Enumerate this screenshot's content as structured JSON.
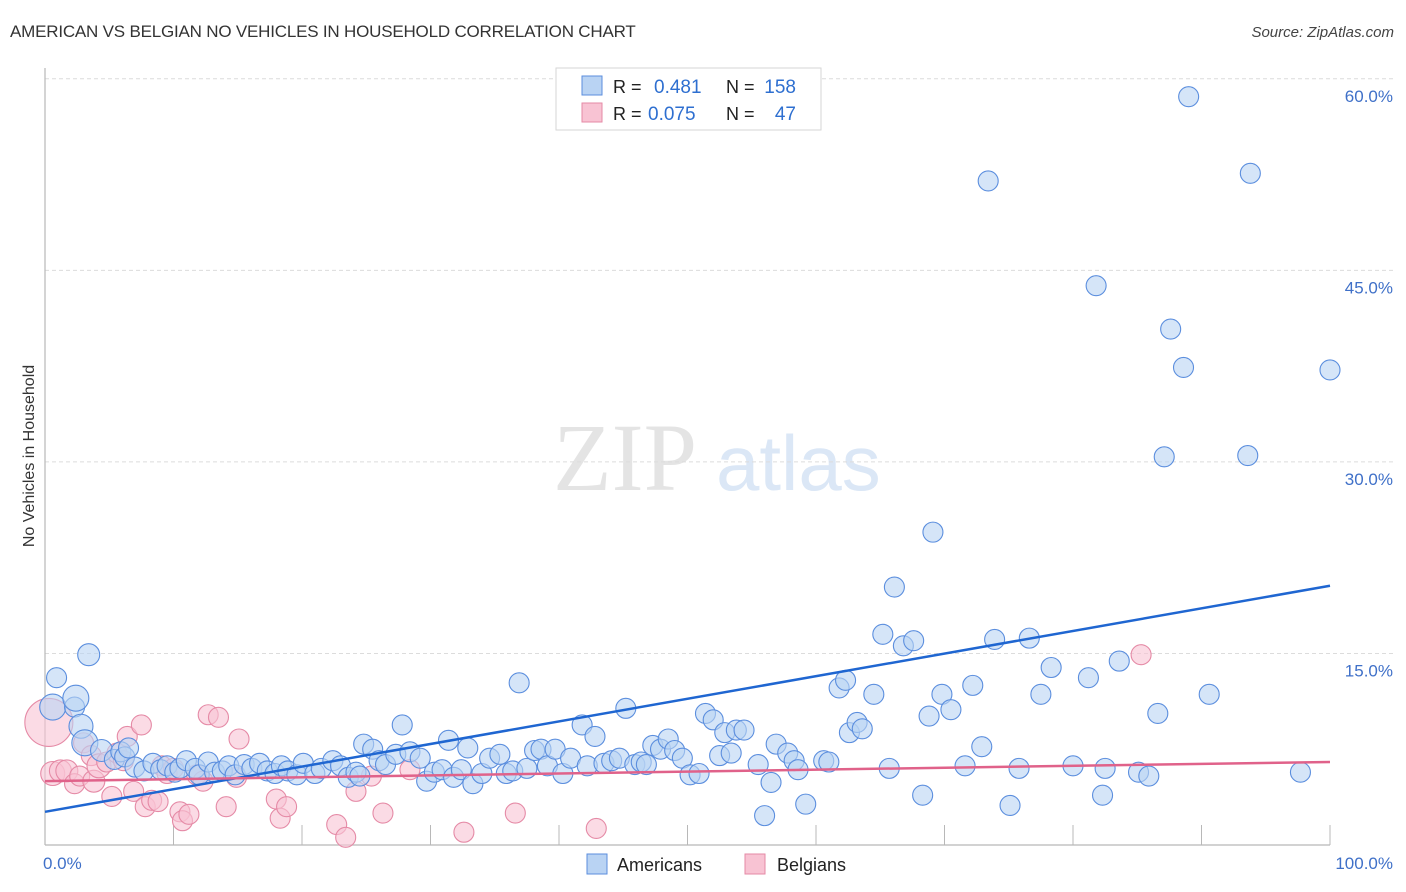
{
  "header": {
    "title": "AMERICAN VS BELGIAN NO VEHICLES IN HOUSEHOLD CORRELATION CHART",
    "source": "Source: ZipAtlas.com"
  },
  "watermark": {
    "zip": "ZIP",
    "atlas": "atlas"
  },
  "colors": {
    "americans_fill": "#b9d3f3",
    "americans_stroke": "#5b8ede",
    "americans_line": "#1f66d1",
    "belgians_fill": "#f8c3d3",
    "belgians_stroke": "#e58aa6",
    "belgians_line": "#e0628a",
    "tick_label": "#3f70c8"
  },
  "legend": {
    "rows": [
      {
        "series": "Americans",
        "r_label": "R =",
        "r_value": "0.481",
        "n_label": "N =",
        "n_value": "158"
      },
      {
        "series": "Belgians",
        "r_label": "R =",
        "r_value": "0.075",
        "n_label": "N =",
        "n_value": "47"
      }
    ]
  },
  "bottom_legend": [
    {
      "label": "Americans"
    },
    {
      "label": "Belgians"
    }
  ],
  "chart_data": {
    "type": "scatter",
    "title": "AMERICAN VS BELGIAN NO VEHICLES IN HOUSEHOLD CORRELATION CHART",
    "xlabel": "",
    "ylabel": "No Vehicles in Household",
    "xlim": [
      0,
      100
    ],
    "ylim": [
      0,
      60
    ],
    "x_tick_labels": [
      "0.0%",
      "100.0%"
    ],
    "y_ticks": [
      15,
      30,
      45,
      60
    ],
    "y_tick_labels": [
      "15.0%",
      "30.0%",
      "45.0%",
      "60.0%"
    ],
    "grid": "horizontal-dashed",
    "legend_position": "top-center",
    "series": [
      {
        "name": "Americans",
        "R": 0.481,
        "N": 158,
        "trend": {
          "x": [
            0,
            100
          ],
          "y": [
            2.6,
            20.3
          ]
        },
        "points": [
          [
            0.6,
            10.8,
            1.3
          ],
          [
            0.9,
            13.1,
            1.0
          ],
          [
            2.3,
            10.8,
            1.0
          ],
          [
            2.4,
            11.5,
            1.3
          ],
          [
            2.8,
            9.3,
            1.2
          ],
          [
            3.4,
            14.9,
            1.1
          ],
          [
            3.1,
            8.0,
            1.3
          ],
          [
            4.4,
            7.4,
            1.1
          ],
          [
            5.4,
            6.7,
            1.0
          ],
          [
            5.9,
            7.3,
            1.0
          ],
          [
            6.2,
            6.9,
            1.0
          ],
          [
            6.5,
            7.6,
            1.0
          ],
          [
            7.0,
            6.1,
            1.0
          ],
          [
            7.7,
            5.8,
            1.0
          ],
          [
            8.4,
            6.4,
            1.0
          ],
          [
            9.0,
            5.9,
            1.0
          ],
          [
            9.5,
            6.2,
            1.0
          ],
          [
            10.1,
            5.7,
            1.0
          ],
          [
            10.5,
            6.0,
            1.0
          ],
          [
            11.0,
            6.6,
            1.0
          ],
          [
            11.7,
            6.0,
            1.0
          ],
          [
            12.0,
            5.5,
            1.0
          ],
          [
            12.7,
            6.5,
            1.0
          ],
          [
            13.2,
            5.7,
            1.0
          ],
          [
            13.8,
            5.8,
            1.0
          ],
          [
            14.3,
            6.2,
            1.0
          ],
          [
            14.8,
            5.5,
            1.0
          ],
          [
            15.5,
            6.3,
            1.0
          ],
          [
            16.1,
            6.0,
            1.0
          ],
          [
            16.7,
            6.4,
            1.0
          ],
          [
            17.3,
            5.8,
            1.0
          ],
          [
            17.9,
            5.6,
            1.0
          ],
          [
            18.4,
            6.2,
            1.0
          ],
          [
            18.9,
            5.8,
            1.0
          ],
          [
            19.6,
            5.5,
            1.0
          ],
          [
            20.1,
            6.4,
            1.0
          ],
          [
            21.0,
            5.6,
            1.0
          ],
          [
            21.5,
            6.0,
            1.0
          ],
          [
            22.4,
            6.6,
            1.0
          ],
          [
            23.0,
            6.2,
            1.0
          ],
          [
            23.6,
            5.3,
            1.0
          ],
          [
            24.2,
            5.7,
            1.0
          ],
          [
            24.5,
            5.4,
            1.0
          ],
          [
            24.8,
            7.9,
            1.0
          ],
          [
            25.5,
            7.5,
            1.0
          ],
          [
            26.0,
            6.6,
            1.0
          ],
          [
            26.5,
            6.3,
            1.0
          ],
          [
            27.3,
            7.1,
            1.0
          ],
          [
            27.8,
            9.4,
            1.0
          ],
          [
            28.4,
            7.3,
            1.0
          ],
          [
            29.2,
            6.8,
            1.0
          ],
          [
            29.7,
            5.0,
            1.0
          ],
          [
            30.3,
            5.7,
            1.0
          ],
          [
            30.9,
            5.9,
            1.0
          ],
          [
            31.4,
            8.2,
            1.0
          ],
          [
            31.8,
            5.3,
            1.0
          ],
          [
            32.4,
            5.9,
            1.0
          ],
          [
            32.9,
            7.6,
            1.0
          ],
          [
            33.3,
            4.8,
            1.0
          ],
          [
            34.0,
            5.6,
            1.0
          ],
          [
            34.6,
            6.8,
            1.0
          ],
          [
            35.4,
            7.1,
            1.0
          ],
          [
            35.9,
            5.6,
            1.0
          ],
          [
            36.4,
            5.8,
            1.0
          ],
          [
            36.9,
            12.7,
            1.0
          ],
          [
            37.5,
            6.0,
            1.0
          ],
          [
            38.1,
            7.4,
            1.0
          ],
          [
            38.6,
            7.5,
            1.0
          ],
          [
            39.1,
            6.2,
            1.0
          ],
          [
            39.7,
            7.5,
            1.0
          ],
          [
            40.3,
            5.6,
            1.0
          ],
          [
            40.9,
            6.8,
            1.0
          ],
          [
            41.8,
            9.4,
            1.0
          ],
          [
            42.2,
            6.2,
            1.0
          ],
          [
            42.8,
            8.5,
            1.0
          ],
          [
            43.5,
            6.4,
            1.0
          ],
          [
            44.1,
            6.6,
            1.0
          ],
          [
            44.7,
            6.8,
            1.0
          ],
          [
            45.2,
            10.7,
            1.0
          ],
          [
            45.9,
            6.3,
            1.0
          ],
          [
            46.4,
            6.5,
            1.0
          ],
          [
            46.8,
            6.3,
            1.0
          ],
          [
            47.3,
            7.8,
            1.0
          ],
          [
            47.9,
            7.5,
            1.0
          ],
          [
            48.5,
            8.3,
            1.0
          ],
          [
            49.0,
            7.4,
            1.0
          ],
          [
            49.6,
            6.8,
            1.0
          ],
          [
            50.2,
            5.5,
            1.0
          ],
          [
            50.9,
            5.6,
            1.0
          ],
          [
            51.4,
            10.3,
            1.0
          ],
          [
            52.0,
            9.8,
            1.0
          ],
          [
            52.5,
            7.0,
            1.0
          ],
          [
            52.9,
            8.8,
            1.0
          ],
          [
            53.4,
            7.2,
            1.0
          ],
          [
            53.8,
            9.0,
            1.0
          ],
          [
            54.4,
            9.0,
            1.0
          ],
          [
            55.5,
            6.3,
            1.0
          ],
          [
            56.0,
            2.3,
            1.0
          ],
          [
            56.5,
            4.9,
            1.0
          ],
          [
            56.9,
            7.9,
            1.0
          ],
          [
            57.8,
            7.2,
            1.0
          ],
          [
            58.3,
            6.6,
            1.0
          ],
          [
            58.6,
            5.9,
            1.0
          ],
          [
            59.2,
            3.2,
            1.0
          ],
          [
            60.6,
            6.6,
            1.0
          ],
          [
            61.0,
            6.5,
            1.0
          ],
          [
            61.8,
            12.3,
            1.0
          ],
          [
            62.3,
            12.9,
            1.0
          ],
          [
            62.6,
            8.8,
            1.0
          ],
          [
            63.2,
            9.6,
            1.0
          ],
          [
            63.6,
            9.1,
            1.0
          ],
          [
            64.5,
            11.8,
            1.0
          ],
          [
            65.2,
            16.5,
            1.0
          ],
          [
            65.7,
            6.0,
            1.0
          ],
          [
            66.1,
            20.2,
            1.0
          ],
          [
            66.8,
            15.6,
            1.0
          ],
          [
            67.6,
            16.0,
            1.0
          ],
          [
            68.3,
            3.9,
            1.0
          ],
          [
            68.8,
            10.1,
            1.0
          ],
          [
            69.1,
            24.5,
            1.0
          ],
          [
            69.8,
            11.8,
            1.0
          ],
          [
            70.5,
            10.6,
            1.0
          ],
          [
            71.6,
            6.2,
            1.0
          ],
          [
            72.2,
            12.5,
            1.0
          ],
          [
            72.9,
            7.7,
            1.0
          ],
          [
            73.4,
            52.0,
            1.0
          ],
          [
            73.9,
            16.1,
            1.0
          ],
          [
            75.1,
            3.1,
            1.0
          ],
          [
            75.8,
            6.0,
            1.0
          ],
          [
            76.6,
            16.2,
            1.0
          ],
          [
            77.5,
            11.8,
            1.0
          ],
          [
            78.3,
            13.9,
            1.0
          ],
          [
            80.0,
            6.2,
            1.0
          ],
          [
            81.2,
            13.1,
            1.0
          ],
          [
            81.8,
            43.8,
            1.0
          ],
          [
            82.3,
            3.9,
            1.0
          ],
          [
            82.5,
            6.0,
            1.0
          ],
          [
            83.6,
            14.4,
            1.0
          ],
          [
            85.1,
            5.7,
            1.0
          ],
          [
            85.9,
            5.4,
            1.0
          ],
          [
            86.6,
            10.3,
            1.0
          ],
          [
            87.1,
            30.4,
            1.0
          ],
          [
            87.6,
            40.4,
            1.0
          ],
          [
            88.6,
            37.4,
            1.0
          ],
          [
            89.0,
            58.6,
            1.0
          ],
          [
            90.6,
            11.8,
            1.0
          ],
          [
            93.6,
            30.5,
            1.0
          ],
          [
            93.8,
            52.6,
            1.0
          ],
          [
            97.7,
            5.7,
            1.0
          ],
          [
            100.0,
            37.2,
            1.0
          ]
        ]
      },
      {
        "name": "Belgians",
        "R": 0.075,
        "N": 47,
        "trend": {
          "x": [
            0,
            100
          ],
          "y": [
            5.0,
            6.5
          ]
        },
        "points": [
          [
            0.3,
            9.6,
            2.4
          ],
          [
            0.6,
            5.6,
            1.2
          ],
          [
            1.2,
            5.8,
            1.1
          ],
          [
            1.7,
            5.8,
            1.1
          ],
          [
            2.3,
            4.8,
            1.0
          ],
          [
            2.7,
            5.4,
            1.0
          ],
          [
            3.0,
            8.0,
            1.0
          ],
          [
            3.6,
            7.0,
            1.0
          ],
          [
            3.8,
            5.0,
            1.1
          ],
          [
            4.2,
            6.2,
            1.2
          ],
          [
            4.8,
            6.5,
            1.0
          ],
          [
            5.2,
            3.8,
            1.0
          ],
          [
            5.6,
            7.2,
            1.0
          ],
          [
            6.1,
            6.6,
            1.0
          ],
          [
            6.4,
            8.5,
            1.0
          ],
          [
            6.9,
            4.2,
            1.0
          ],
          [
            7.5,
            9.4,
            1.0
          ],
          [
            7.8,
            3.0,
            1.0
          ],
          [
            8.3,
            3.5,
            1.0
          ],
          [
            8.8,
            3.4,
            1.0
          ],
          [
            9.1,
            6.2,
            1.0
          ],
          [
            9.5,
            5.6,
            1.0
          ],
          [
            10.0,
            6.0,
            1.0
          ],
          [
            10.5,
            2.6,
            1.0
          ],
          [
            10.7,
            1.9,
            1.0
          ],
          [
            11.2,
            2.4,
            1.0
          ],
          [
            11.8,
            5.5,
            1.0
          ],
          [
            12.3,
            5.0,
            1.0
          ],
          [
            12.7,
            10.2,
            1.0
          ],
          [
            13.5,
            10.0,
            1.0
          ],
          [
            14.1,
            3.0,
            1.0
          ],
          [
            14.9,
            5.3,
            1.0
          ],
          [
            15.1,
            8.3,
            1.0
          ],
          [
            18.0,
            3.6,
            1.0
          ],
          [
            18.3,
            2.1,
            1.0
          ],
          [
            18.8,
            3.0,
            1.0
          ],
          [
            22.7,
            1.6,
            1.0
          ],
          [
            23.4,
            0.6,
            1.0
          ],
          [
            24.2,
            4.2,
            1.0
          ],
          [
            25.4,
            5.4,
            1.0
          ],
          [
            26.3,
            2.5,
            1.0
          ],
          [
            28.4,
            5.9,
            1.0
          ],
          [
            32.6,
            1.0,
            1.0
          ],
          [
            36.6,
            2.5,
            1.0
          ],
          [
            42.9,
            1.3,
            1.0
          ],
          [
            85.3,
            14.9,
            1.0
          ],
          [
            87.0,
            14.8,
            0.0
          ]
        ]
      }
    ]
  }
}
